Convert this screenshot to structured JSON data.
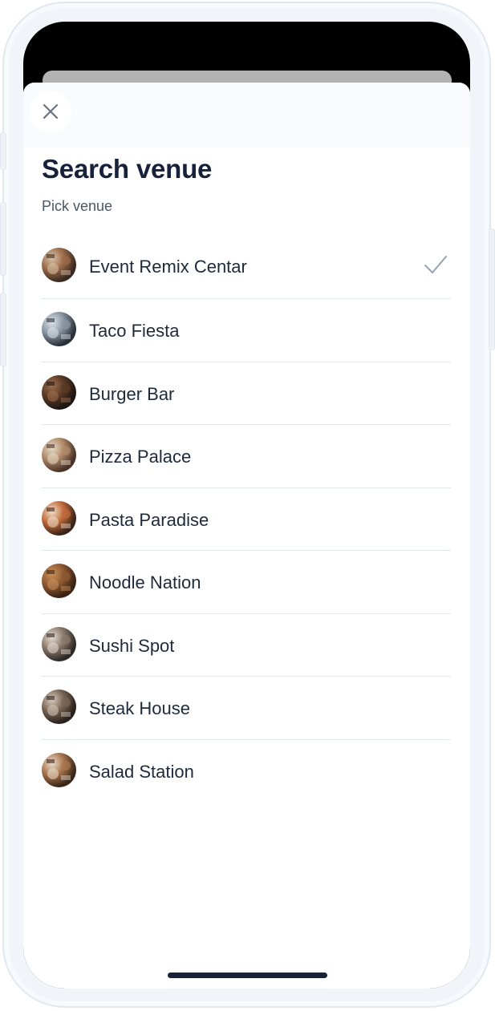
{
  "header": {
    "close_icon": "close-icon"
  },
  "title": "Search venue",
  "subtitle": "Pick venue",
  "venues": [
    {
      "label": "Event Remix Centar",
      "selected": true,
      "thumb_colors": [
        "#3a2a22",
        "#9b6b4a",
        "#d9c4a8"
      ]
    },
    {
      "label": "Taco Fiesta",
      "selected": false,
      "thumb_colors": [
        "#2b3138",
        "#8a96a3",
        "#dfe4ea"
      ]
    },
    {
      "label": "Burger Bar",
      "selected": false,
      "thumb_colors": [
        "#1d1612",
        "#5a3a25",
        "#a07050"
      ]
    },
    {
      "label": "Pizza Palace",
      "selected": false,
      "thumb_colors": [
        "#4a3326",
        "#b08a6a",
        "#e8dccb"
      ]
    },
    {
      "label": "Pasta Paradise",
      "selected": false,
      "thumb_colors": [
        "#3b2418",
        "#c26b3a",
        "#efe2d0"
      ]
    },
    {
      "label": "Noodle Nation",
      "selected": false,
      "thumb_colors": [
        "#3a2214",
        "#8f5a32",
        "#c9925c"
      ]
    },
    {
      "label": "Sushi Spot",
      "selected": false,
      "thumb_colors": [
        "#2f2a28",
        "#8c7a6c",
        "#e6ded4"
      ]
    },
    {
      "label": "Steak House",
      "selected": false,
      "thumb_colors": [
        "#2a211c",
        "#7a6656",
        "#d8cabb"
      ]
    },
    {
      "label": "Salad Station",
      "selected": false,
      "thumb_colors": [
        "#3b261a",
        "#a8754e",
        "#ece0d0"
      ]
    }
  ],
  "selected_icon": "checkmark-icon",
  "colors": {
    "title": "#16213a",
    "text": "#1e293b",
    "muted": "#4a5568",
    "divider": "#e2e8f0",
    "check": "#94a3b8"
  }
}
